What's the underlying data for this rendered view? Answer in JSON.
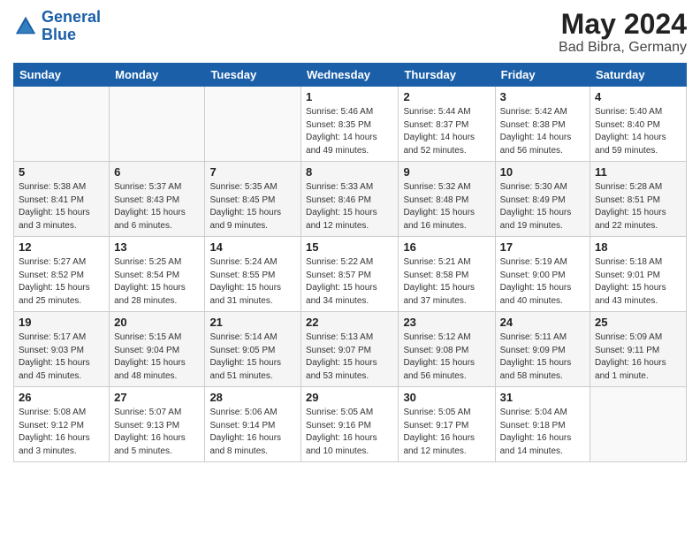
{
  "header": {
    "logo_line1": "General",
    "logo_line2": "Blue",
    "month_year": "May 2024",
    "location": "Bad Bibra, Germany"
  },
  "weekdays": [
    "Sunday",
    "Monday",
    "Tuesday",
    "Wednesday",
    "Thursday",
    "Friday",
    "Saturday"
  ],
  "weeks": [
    [
      {
        "day": "",
        "info": ""
      },
      {
        "day": "",
        "info": ""
      },
      {
        "day": "",
        "info": ""
      },
      {
        "day": "1",
        "info": "Sunrise: 5:46 AM\nSunset: 8:35 PM\nDaylight: 14 hours\nand 49 minutes."
      },
      {
        "day": "2",
        "info": "Sunrise: 5:44 AM\nSunset: 8:37 PM\nDaylight: 14 hours\nand 52 minutes."
      },
      {
        "day": "3",
        "info": "Sunrise: 5:42 AM\nSunset: 8:38 PM\nDaylight: 14 hours\nand 56 minutes."
      },
      {
        "day": "4",
        "info": "Sunrise: 5:40 AM\nSunset: 8:40 PM\nDaylight: 14 hours\nand 59 minutes."
      }
    ],
    [
      {
        "day": "5",
        "info": "Sunrise: 5:38 AM\nSunset: 8:41 PM\nDaylight: 15 hours\nand 3 minutes."
      },
      {
        "day": "6",
        "info": "Sunrise: 5:37 AM\nSunset: 8:43 PM\nDaylight: 15 hours\nand 6 minutes."
      },
      {
        "day": "7",
        "info": "Sunrise: 5:35 AM\nSunset: 8:45 PM\nDaylight: 15 hours\nand 9 minutes."
      },
      {
        "day": "8",
        "info": "Sunrise: 5:33 AM\nSunset: 8:46 PM\nDaylight: 15 hours\nand 12 minutes."
      },
      {
        "day": "9",
        "info": "Sunrise: 5:32 AM\nSunset: 8:48 PM\nDaylight: 15 hours\nand 16 minutes."
      },
      {
        "day": "10",
        "info": "Sunrise: 5:30 AM\nSunset: 8:49 PM\nDaylight: 15 hours\nand 19 minutes."
      },
      {
        "day": "11",
        "info": "Sunrise: 5:28 AM\nSunset: 8:51 PM\nDaylight: 15 hours\nand 22 minutes."
      }
    ],
    [
      {
        "day": "12",
        "info": "Sunrise: 5:27 AM\nSunset: 8:52 PM\nDaylight: 15 hours\nand 25 minutes."
      },
      {
        "day": "13",
        "info": "Sunrise: 5:25 AM\nSunset: 8:54 PM\nDaylight: 15 hours\nand 28 minutes."
      },
      {
        "day": "14",
        "info": "Sunrise: 5:24 AM\nSunset: 8:55 PM\nDaylight: 15 hours\nand 31 minutes."
      },
      {
        "day": "15",
        "info": "Sunrise: 5:22 AM\nSunset: 8:57 PM\nDaylight: 15 hours\nand 34 minutes."
      },
      {
        "day": "16",
        "info": "Sunrise: 5:21 AM\nSunset: 8:58 PM\nDaylight: 15 hours\nand 37 minutes."
      },
      {
        "day": "17",
        "info": "Sunrise: 5:19 AM\nSunset: 9:00 PM\nDaylight: 15 hours\nand 40 minutes."
      },
      {
        "day": "18",
        "info": "Sunrise: 5:18 AM\nSunset: 9:01 PM\nDaylight: 15 hours\nand 43 minutes."
      }
    ],
    [
      {
        "day": "19",
        "info": "Sunrise: 5:17 AM\nSunset: 9:03 PM\nDaylight: 15 hours\nand 45 minutes."
      },
      {
        "day": "20",
        "info": "Sunrise: 5:15 AM\nSunset: 9:04 PM\nDaylight: 15 hours\nand 48 minutes."
      },
      {
        "day": "21",
        "info": "Sunrise: 5:14 AM\nSunset: 9:05 PM\nDaylight: 15 hours\nand 51 minutes."
      },
      {
        "day": "22",
        "info": "Sunrise: 5:13 AM\nSunset: 9:07 PM\nDaylight: 15 hours\nand 53 minutes."
      },
      {
        "day": "23",
        "info": "Sunrise: 5:12 AM\nSunset: 9:08 PM\nDaylight: 15 hours\nand 56 minutes."
      },
      {
        "day": "24",
        "info": "Sunrise: 5:11 AM\nSunset: 9:09 PM\nDaylight: 15 hours\nand 58 minutes."
      },
      {
        "day": "25",
        "info": "Sunrise: 5:09 AM\nSunset: 9:11 PM\nDaylight: 16 hours\nand 1 minute."
      }
    ],
    [
      {
        "day": "26",
        "info": "Sunrise: 5:08 AM\nSunset: 9:12 PM\nDaylight: 16 hours\nand 3 minutes."
      },
      {
        "day": "27",
        "info": "Sunrise: 5:07 AM\nSunset: 9:13 PM\nDaylight: 16 hours\nand 5 minutes."
      },
      {
        "day": "28",
        "info": "Sunrise: 5:06 AM\nSunset: 9:14 PM\nDaylight: 16 hours\nand 8 minutes."
      },
      {
        "day": "29",
        "info": "Sunrise: 5:05 AM\nSunset: 9:16 PM\nDaylight: 16 hours\nand 10 minutes."
      },
      {
        "day": "30",
        "info": "Sunrise: 5:05 AM\nSunset: 9:17 PM\nDaylight: 16 hours\nand 12 minutes."
      },
      {
        "day": "31",
        "info": "Sunrise: 5:04 AM\nSunset: 9:18 PM\nDaylight: 16 hours\nand 14 minutes."
      },
      {
        "day": "",
        "info": ""
      }
    ]
  ]
}
